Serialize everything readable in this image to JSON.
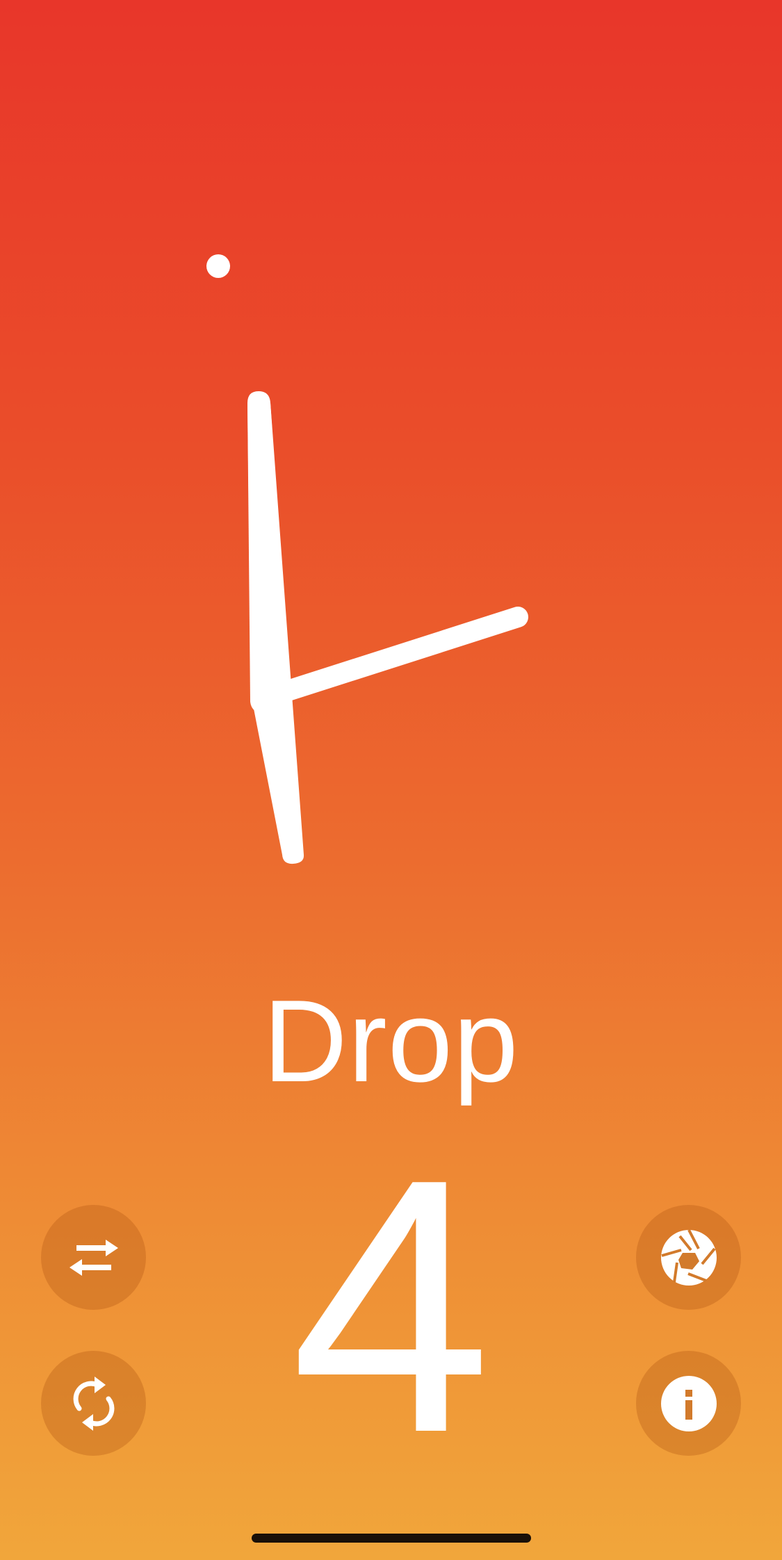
{
  "dial": {
    "hand_color": "#ffffff",
    "indicator_dot": true
  },
  "status": {
    "label": "Drop",
    "count": "4"
  },
  "buttons": {
    "swap": "swap-arrows-icon",
    "rotate": "rotate-arrows-icon",
    "shutter": "aperture-icon",
    "info": "info-icon"
  },
  "colors": {
    "gradient_top": "#e8362a",
    "gradient_bottom": "#f1a63b",
    "button_fill": "rgba(180,90,20,0.35)"
  }
}
